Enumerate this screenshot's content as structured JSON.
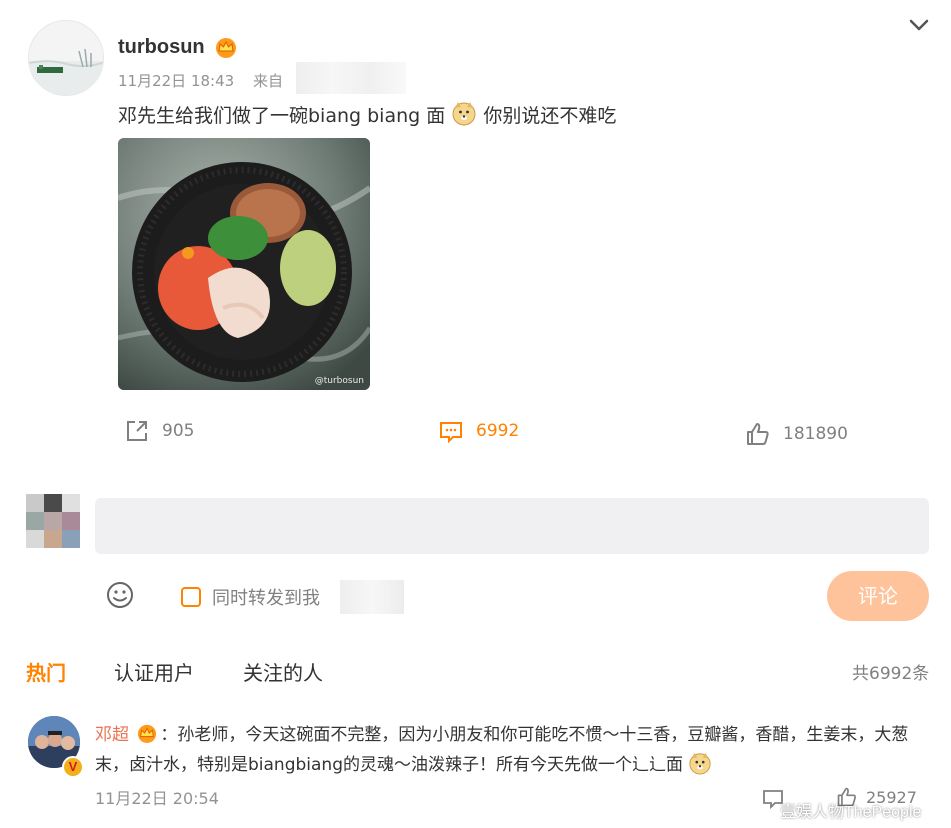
{
  "post": {
    "username": "turbosun",
    "timestamp": "11月22日 18:43",
    "source_label": "来自",
    "text_before": "邓先生给我们做了一碗biang biang 面",
    "text_after": "你别说还不难吃",
    "image_watermark": "@turbosun"
  },
  "actions": {
    "repost_count": "905",
    "comment_count": "6992",
    "like_count": "181890"
  },
  "composer": {
    "forward_label": "同时转发到我",
    "submit_label": "评论"
  },
  "tabs": [
    {
      "label": "热门"
    },
    {
      "label": "认证用户"
    },
    {
      "label": "关注的人"
    }
  ],
  "total_count": "共6992条",
  "comment": {
    "author": "邓超",
    "text": "：孙老师，今天这碗面不完整，因为小朋友和你可能吃不惯～十三香，豆瓣酱，香醋，生姜末，大葱末，卤汁水，特别是biangbiang的灵魂～油泼辣子！所有今天先做一个辶辶面",
    "time": "11月22日 20:54",
    "like_count": "25927",
    "badge": "V"
  },
  "site_watermark": "壹娱人物ThePeople",
  "colors": {
    "accent": "#ff8200",
    "name_orange": "#eb7350",
    "muted": "#939393",
    "input_bg": "#f0f0f2",
    "button_disabled": "#ffc39b"
  }
}
